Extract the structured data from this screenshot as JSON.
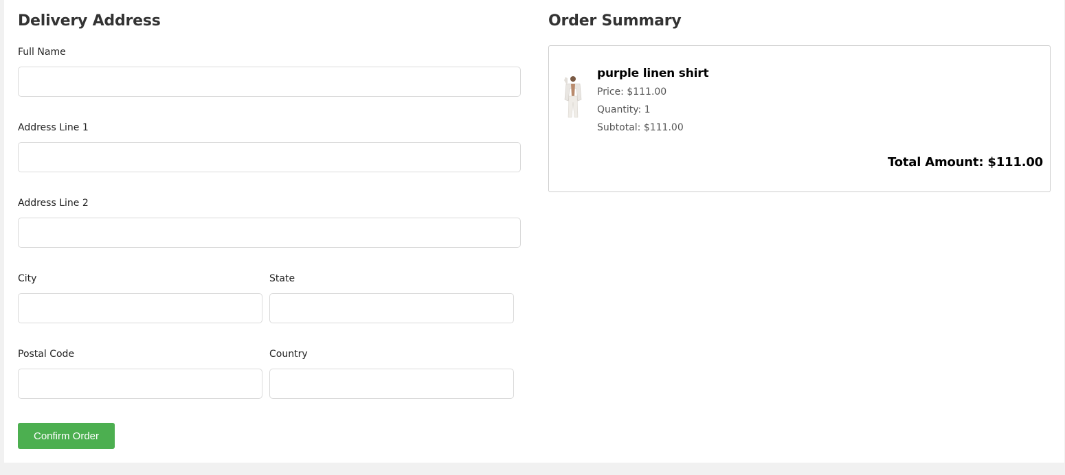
{
  "delivery": {
    "title": "Delivery Address",
    "fields": {
      "full_name": {
        "label": "Full Name",
        "value": ""
      },
      "address_line_1": {
        "label": "Address Line 1",
        "value": ""
      },
      "address_line_2": {
        "label": "Address Line 2",
        "value": ""
      },
      "city": {
        "label": "City",
        "value": ""
      },
      "state": {
        "label": "State",
        "value": ""
      },
      "postal_code": {
        "label": "Postal Code",
        "value": ""
      },
      "country": {
        "label": "Country",
        "value": ""
      }
    },
    "confirm_label": "Confirm Order"
  },
  "summary": {
    "title": "Order Summary",
    "item": {
      "name": "purple linen shirt",
      "price": "Price: $111.00",
      "quantity": "Quantity: 1",
      "subtotal": "Subtotal: $111.00",
      "image": "product-photo"
    },
    "total_label": "Total Amount:",
    "total_value": "$111.00"
  },
  "colors": {
    "confirm_button": "#4caf50",
    "heading": "#333333",
    "input_border": "#d9d9d9",
    "box_border": "#cccccc",
    "page_background": "#f1f1f1"
  }
}
